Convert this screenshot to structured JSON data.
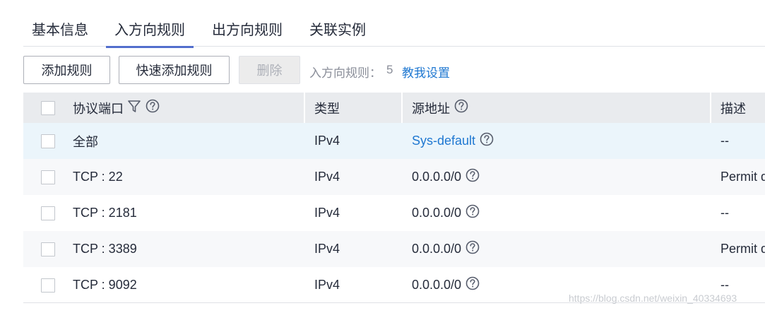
{
  "tabs": [
    {
      "label": "基本信息",
      "active": false
    },
    {
      "label": "入方向规则",
      "active": true
    },
    {
      "label": "出方向规则",
      "active": false
    },
    {
      "label": "关联实例",
      "active": false
    }
  ],
  "toolbar": {
    "add_label": "添加规则",
    "quick_add_label": "快速添加规则",
    "delete_label": "删除",
    "rule_count_label": "入方向规则：",
    "rule_count_value": "5",
    "help_link": "教我设置"
  },
  "table": {
    "headers": {
      "protocol_port": "协议端口",
      "type": "类型",
      "source": "源地址",
      "description": "描述"
    },
    "rows": [
      {
        "protocol_port": "全部",
        "type": "IPv4",
        "source": "Sys-default",
        "description": "--"
      },
      {
        "protocol_port": "TCP : 22",
        "type": "IPv4",
        "source": "0.0.0.0/0",
        "description": "Permit d"
      },
      {
        "protocol_port": "TCP : 2181",
        "type": "IPv4",
        "source": "0.0.0.0/0",
        "description": "--"
      },
      {
        "protocol_port": "TCP : 3389",
        "type": "IPv4",
        "source": "0.0.0.0/0",
        "description": "Permit d"
      },
      {
        "protocol_port": "TCP : 9092",
        "type": "IPv4",
        "source": "0.0.0.0/0",
        "description": "--"
      }
    ]
  },
  "watermark": "https://blog.csdn.net/weixin_40334693",
  "colors": {
    "accent": "#526ecc",
    "link": "#1f78d1",
    "header_bg": "#e9ebee",
    "highlight_row": "#ebf5fb"
  }
}
